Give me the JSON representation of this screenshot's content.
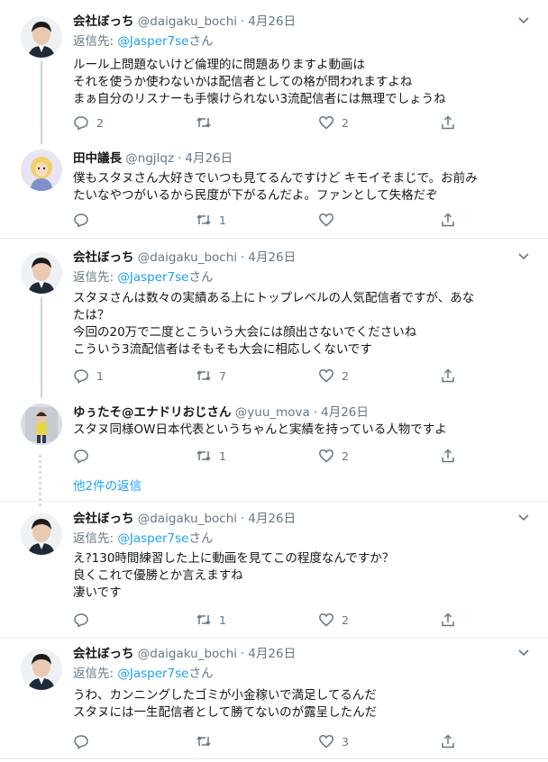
{
  "tweets": [
    {
      "name": "会社ぼっち",
      "handle": "@daigaku_bochi",
      "date": "4月26日",
      "reply_prefix": "返信先: ",
      "reply_mention": "@Jasper7se",
      "reply_suffix": "さん",
      "lines": [
        "ルール上問題ないけど倫理的に問題ありますよ動画は",
        "それを使うか使わないかは配信者としての格が問われますよね",
        "まぁ自分のリスナーも手懐けられない3流配信者には無理でしょうね"
      ],
      "reply_count": "2",
      "retweet_count": "",
      "like_count": "2"
    },
    {
      "name": "田中議長",
      "handle": "@ngjlqz",
      "date": "4月26日",
      "lines": [
        "僕もスタヌさん大好きでいつも見てるんですけど キモイそまじで。お前み",
        "たいなやつがいるから民度が下がるんだよ。ファンとして失格だぞ"
      ],
      "reply_count": "",
      "retweet_count": "1",
      "like_count": ""
    },
    {
      "name": "会社ぼっち",
      "handle": "@daigaku_bochi",
      "date": "4月26日",
      "reply_prefix": "返信先: ",
      "reply_mention": "@Jasper7se",
      "reply_suffix": "さん",
      "lines": [
        "スタヌさんは数々の実績ある上にトップレベルの人気配信者ですが、あな",
        "たは？",
        "今回の20万で二度とこういう大会には顔出さないでくださいね",
        "こういう3流配信者はそもそも大会に相応しくないです"
      ],
      "reply_count": "1",
      "retweet_count": "7",
      "like_count": "2"
    },
    {
      "name": "ゆぅたそ@エナドリおじさん",
      "handle": "@yuu_mova",
      "date": "4月26日",
      "lines": [
        "スタヌ同様OW日本代表というちゃんと実績を持っている人物ですよ"
      ],
      "reply_count": "",
      "retweet_count": "1",
      "like_count": "2"
    },
    {
      "name": "会社ぼっち",
      "handle": "@daigaku_bochi",
      "date": "4月26日",
      "reply_prefix": "返信先: ",
      "reply_mention": "@Jasper7se",
      "reply_suffix": "さん",
      "lines": [
        "え?130時間練習した上に動画を見てこの程度なんですか？",
        "良くこれで優勝とか言えますね",
        "凄いです"
      ],
      "reply_count": "",
      "retweet_count": "1",
      "like_count": "2"
    },
    {
      "name": "会社ぼっち",
      "handle": "@daigaku_bochi",
      "date": "4月26日",
      "reply_prefix": "返信先: ",
      "reply_mention": "@Jasper7se",
      "reply_suffix": "さん",
      "lines": [
        "うわ、カンニングしたゴミが小金稼いで満足してるんだ",
        "スタヌには一生配信者として勝てないのが露呈したんだ"
      ],
      "reply_count": "",
      "retweet_count": "",
      "like_count": "3"
    }
  ],
  "more_replies_label": "他2件の返信",
  "colors": {
    "accent": "#1da1f2",
    "muted": "#657786",
    "divider": "#e6ecf0",
    "thread": "#ccd6dd"
  }
}
